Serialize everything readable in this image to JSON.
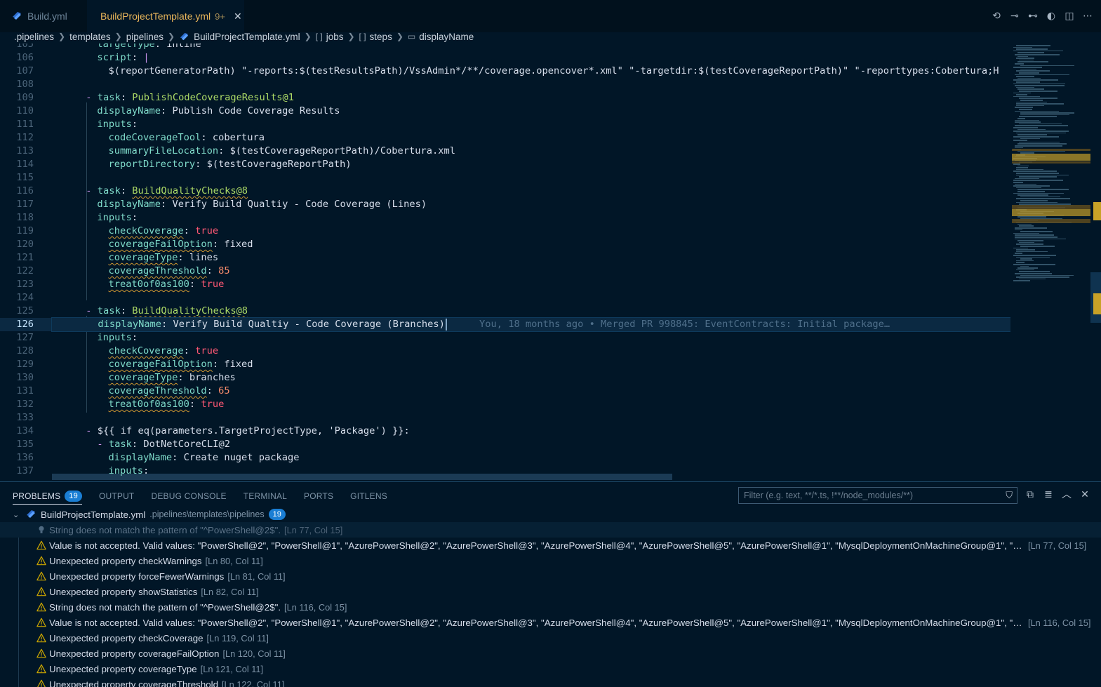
{
  "tabs": [
    {
      "label": "Build.yml",
      "active": false
    },
    {
      "label": "BuildProjectTemplate.yml",
      "active": true,
      "modified": "9+"
    }
  ],
  "breadcrumbs": [
    ".pipelines",
    "templates",
    "pipelines",
    "BuildProjectTemplate.yml",
    "jobs",
    "steps",
    "displayName"
  ],
  "editor": {
    "lines": [
      {
        "n": "105",
        "indent": 8,
        "parts": [
          [
            "k",
            "targetType"
          ],
          [
            "v",
            ": "
          ],
          [
            "v",
            "inline"
          ]
        ]
      },
      {
        "n": "106",
        "indent": 8,
        "parts": [
          [
            "k",
            "script"
          ],
          [
            "v",
            ": "
          ],
          [
            "p",
            "|"
          ]
        ]
      },
      {
        "n": "107",
        "indent": 10,
        "parts": [
          [
            "v",
            "$(reportGeneratorPath) \"-reports:$(testResultsPath)/VssAdmin*/**/coverage.opencover*.xml\" \"-targetdir:$(testCoverageReportPath)\" \"-reporttypes:Cobertura;H"
          ]
        ]
      },
      {
        "n": "108",
        "indent": 0,
        "parts": []
      },
      {
        "n": "109",
        "indent": 6,
        "parts": [
          [
            "p",
            "- "
          ],
          [
            "k",
            "task"
          ],
          [
            "v",
            ": "
          ],
          [
            "tag",
            "PublishCodeCoverageResults@1"
          ]
        ]
      },
      {
        "n": "110",
        "indent": 8,
        "parts": [
          [
            "k",
            "displayName"
          ],
          [
            "v",
            ": "
          ],
          [
            "v",
            "Publish Code Coverage Results"
          ]
        ]
      },
      {
        "n": "111",
        "indent": 8,
        "parts": [
          [
            "k",
            "inputs"
          ],
          [
            "v",
            ":"
          ]
        ]
      },
      {
        "n": "112",
        "indent": 10,
        "parts": [
          [
            "k",
            "codeCoverageTool"
          ],
          [
            "v",
            ": "
          ],
          [
            "v",
            "cobertura"
          ]
        ]
      },
      {
        "n": "113",
        "indent": 10,
        "parts": [
          [
            "k",
            "summaryFileLocation"
          ],
          [
            "v",
            ": "
          ],
          [
            "v",
            "$(testCoverageReportPath)/Cobertura.xml"
          ]
        ]
      },
      {
        "n": "114",
        "indent": 10,
        "parts": [
          [
            "k",
            "reportDirectory"
          ],
          [
            "v",
            ": "
          ],
          [
            "v",
            "$(testCoverageReportPath)"
          ]
        ]
      },
      {
        "n": "115",
        "indent": 0,
        "parts": []
      },
      {
        "n": "116",
        "indent": 6,
        "parts": [
          [
            "p",
            "- "
          ],
          [
            "k",
            "task"
          ],
          [
            "v",
            ": "
          ],
          [
            "tagsq",
            "BuildQualityChecks@8"
          ]
        ]
      },
      {
        "n": "117",
        "indent": 8,
        "parts": [
          [
            "k",
            "displayName"
          ],
          [
            "v",
            ": "
          ],
          [
            "v",
            "Verify Build Qualtiy - Code Coverage (Lines)"
          ]
        ]
      },
      {
        "n": "118",
        "indent": 8,
        "parts": [
          [
            "k",
            "inputs"
          ],
          [
            "v",
            ":"
          ]
        ]
      },
      {
        "n": "119",
        "indent": 10,
        "parts": [
          [
            "ksq",
            "checkCoverage"
          ],
          [
            "v",
            ": "
          ],
          [
            "bool",
            "true"
          ]
        ]
      },
      {
        "n": "120",
        "indent": 10,
        "parts": [
          [
            "ksq",
            "coverageFailOption"
          ],
          [
            "v",
            ": "
          ],
          [
            "v",
            "fixed"
          ]
        ]
      },
      {
        "n": "121",
        "indent": 10,
        "parts": [
          [
            "ksq",
            "coverageType"
          ],
          [
            "v",
            ": "
          ],
          [
            "v",
            "lines"
          ]
        ]
      },
      {
        "n": "122",
        "indent": 10,
        "parts": [
          [
            "ksq",
            "coverageThreshold"
          ],
          [
            "v",
            ": "
          ],
          [
            "num",
            "85"
          ]
        ]
      },
      {
        "n": "123",
        "indent": 10,
        "parts": [
          [
            "ksq",
            "treat0of0as100"
          ],
          [
            "v",
            ": "
          ],
          [
            "bool",
            "true"
          ]
        ]
      },
      {
        "n": "124",
        "indent": 0,
        "parts": []
      },
      {
        "n": "125",
        "indent": 6,
        "parts": [
          [
            "p",
            "- "
          ],
          [
            "k",
            "task"
          ],
          [
            "v",
            ": "
          ],
          [
            "tagsq",
            "BuildQualityChecks@8"
          ]
        ]
      },
      {
        "n": "126",
        "indent": 8,
        "current": true,
        "parts": [
          [
            "k",
            "displayName"
          ],
          [
            "v",
            ": "
          ],
          [
            "v",
            "Verify Build Qualtiy - Code Coverage (Branches)"
          ]
        ]
      },
      {
        "n": "127",
        "indent": 8,
        "parts": [
          [
            "k",
            "inputs"
          ],
          [
            "v",
            ":"
          ]
        ]
      },
      {
        "n": "128",
        "indent": 10,
        "parts": [
          [
            "ksq",
            "checkCoverage"
          ],
          [
            "v",
            ": "
          ],
          [
            "bool",
            "true"
          ]
        ]
      },
      {
        "n": "129",
        "indent": 10,
        "parts": [
          [
            "ksq",
            "coverageFailOption"
          ],
          [
            "v",
            ": "
          ],
          [
            "v",
            "fixed"
          ]
        ]
      },
      {
        "n": "130",
        "indent": 10,
        "parts": [
          [
            "ksq",
            "coverageType"
          ],
          [
            "v",
            ": "
          ],
          [
            "v",
            "branches"
          ]
        ]
      },
      {
        "n": "131",
        "indent": 10,
        "parts": [
          [
            "ksq",
            "coverageThreshold"
          ],
          [
            "v",
            ": "
          ],
          [
            "num",
            "65"
          ]
        ]
      },
      {
        "n": "132",
        "indent": 10,
        "parts": [
          [
            "ksq",
            "treat0of0as100"
          ],
          [
            "v",
            ": "
          ],
          [
            "bool",
            "true"
          ]
        ]
      },
      {
        "n": "133",
        "indent": 0,
        "parts": []
      },
      {
        "n": "134",
        "indent": 6,
        "parts": [
          [
            "p",
            "- "
          ],
          [
            "v",
            "${{ if eq(parameters.TargetProjectType, 'Package') }}:"
          ]
        ]
      },
      {
        "n": "135",
        "indent": 8,
        "parts": [
          [
            "p",
            "- "
          ],
          [
            "k",
            "task"
          ],
          [
            "v",
            ": "
          ],
          [
            "v",
            "DotNetCoreCLI@2"
          ]
        ]
      },
      {
        "n": "136",
        "indent": 10,
        "parts": [
          [
            "k",
            "displayName"
          ],
          [
            "v",
            ": "
          ],
          [
            "v",
            "Create nuget package"
          ]
        ]
      },
      {
        "n": "137",
        "indent": 10,
        "parts": [
          [
            "k",
            "inputs"
          ],
          [
            "v",
            ":"
          ]
        ]
      }
    ],
    "blame": "You, 18 months ago • Merged PR 998845: EventContracts: Initial package…"
  },
  "panel": {
    "tabs": [
      {
        "label": "PROBLEMS",
        "badge": "19",
        "active": true
      },
      {
        "label": "OUTPUT"
      },
      {
        "label": "DEBUG CONSOLE"
      },
      {
        "label": "TERMINAL"
      },
      {
        "label": "PORTS"
      },
      {
        "label": "GITLENS"
      }
    ],
    "filter_placeholder": "Filter (e.g. text, **/*.ts, !**/node_modules/**)",
    "file": {
      "name": "BuildProjectTemplate.yml",
      "path": ".pipelines\\templates\\pipelines",
      "count": "19"
    },
    "problems": [
      {
        "kind": "hint",
        "msg": "String does not match the pattern of \"^PowerShell@2$\".",
        "loc": "[Ln 77, Col 15]"
      },
      {
        "kind": "warn",
        "msg": "Value is not accepted. Valid values: \"PowerShell@2\", \"PowerShell@1\", \"AzurePowerShell@2\", \"AzurePowerShell@3\", \"AzurePowerShell@4\", \"AzurePowerShell@5\", \"AzurePowerShell@1\", \"MysqlDeploymentOnMachineGroup@1\", \"PipAuthentica...",
        "loc": "[Ln 77, Col 15]"
      },
      {
        "kind": "warn",
        "msg": "Unexpected property checkWarnings",
        "loc": "[Ln 80, Col 11]"
      },
      {
        "kind": "warn",
        "msg": "Unexpected property forceFewerWarnings",
        "loc": "[Ln 81, Col 11]"
      },
      {
        "kind": "warn",
        "msg": "Unexpected property showStatistics",
        "loc": "[Ln 82, Col 11]"
      },
      {
        "kind": "warn",
        "msg": "String does not match the pattern of \"^PowerShell@2$\".",
        "loc": "[Ln 116, Col 15]"
      },
      {
        "kind": "warn",
        "msg": "Value is not accepted. Valid values: \"PowerShell@2\", \"PowerShell@1\", \"AzurePowerShell@2\", \"AzurePowerShell@3\", \"AzurePowerShell@4\", \"AzurePowerShell@5\", \"AzurePowerShell@1\", \"MysqlDeploymentOnMachineGroup@1\", \"PipAuthentic...",
        "loc": "[Ln 116, Col 15]"
      },
      {
        "kind": "warn",
        "msg": "Unexpected property checkCoverage",
        "loc": "[Ln 119, Col 11]"
      },
      {
        "kind": "warn",
        "msg": "Unexpected property coverageFailOption",
        "loc": "[Ln 120, Col 11]"
      },
      {
        "kind": "warn",
        "msg": "Unexpected property coverageType",
        "loc": "[Ln 121, Col 11]"
      },
      {
        "kind": "warn",
        "msg": "Unexpected property coverageThreshold",
        "loc": "[Ln 122, Col 11]"
      }
    ]
  },
  "colors": {
    "background": "#011627",
    "accent_tab": "#e7b55a",
    "warning": "#cca700",
    "badge": "#1a7ed4"
  }
}
